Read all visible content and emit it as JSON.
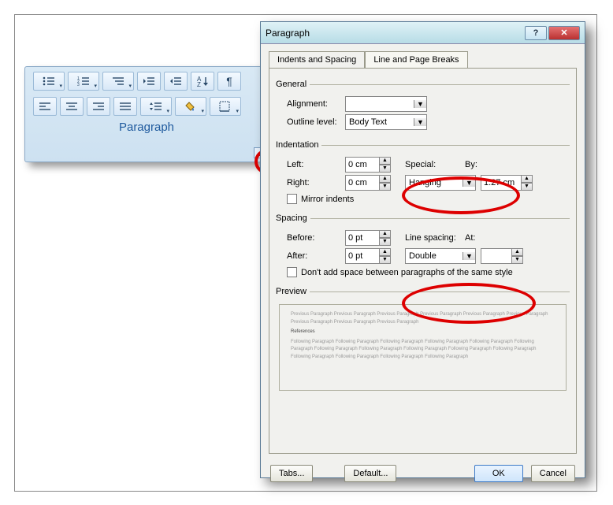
{
  "ribbon": {
    "title": "Paragraph"
  },
  "dialog": {
    "title": "Paragraph",
    "tabs": {
      "indents": "Indents and Spacing",
      "breaks": "Line and Page Breaks"
    },
    "general": {
      "legend": "General",
      "alignment_label": "Alignment:",
      "alignment_value": "",
      "outline_label": "Outline level:",
      "outline_value": "Body Text"
    },
    "indentation": {
      "legend": "Indentation",
      "left_label": "Left:",
      "left_value": "0 cm",
      "right_label": "Right:",
      "right_value": "0 cm",
      "special_label": "Special:",
      "special_value": "Hanging",
      "by_label": "By:",
      "by_value": "1.27 cm",
      "mirror_label": "Mirror indents"
    },
    "spacing": {
      "legend": "Spacing",
      "before_label": "Before:",
      "before_value": "0 pt",
      "after_label": "After:",
      "after_value": "0 pt",
      "linespacing_label": "Line spacing:",
      "linespacing_value": "Double",
      "at_label": "At:",
      "at_value": "",
      "noadd_label": "Don't add space between paragraphs of the same style"
    },
    "preview": {
      "legend": "Preview",
      "prev": "Previous Paragraph Previous Paragraph Previous Paragraph Previous Paragraph Previous Paragraph Previous Paragraph Previous Paragraph Previous Paragraph Previous Paragraph",
      "sample": "References",
      "next": "Following Paragraph Following Paragraph Following Paragraph Following Paragraph Following Paragraph Following Paragraph Following Paragraph Following Paragraph Following Paragraph Following Paragraph Following Paragraph Following Paragraph Following Paragraph Following Paragraph Following Paragraph"
    },
    "buttons": {
      "tabs": "Tabs...",
      "default": "Default...",
      "ok": "OK",
      "cancel": "Cancel"
    }
  }
}
